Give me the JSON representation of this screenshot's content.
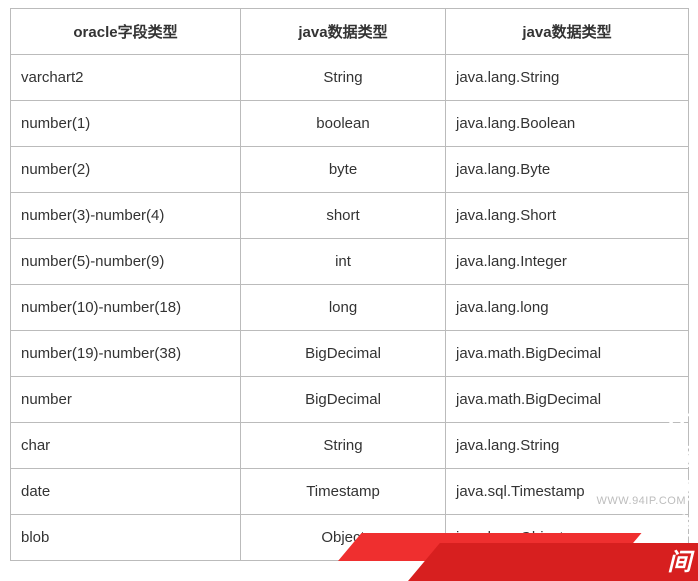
{
  "table": {
    "headers": [
      "oracle字段类型",
      "java数据类型",
      "java数据类型"
    ],
    "rows": [
      [
        "varchart2",
        "String",
        "java.lang.String"
      ],
      [
        "number(1)",
        "boolean",
        "java.lang.Boolean"
      ],
      [
        "number(2)",
        "byte",
        "java.lang.Byte"
      ],
      [
        "number(3)-number(4)",
        "short",
        "java.lang.Short"
      ],
      [
        "number(5)-number(9)",
        "int",
        "java.lang.Integer"
      ],
      [
        "number(10)-number(18)",
        "long",
        "java.lang.long"
      ],
      [
        "number(19)-number(38)",
        "BigDecimal",
        "java.math.BigDecimal"
      ],
      [
        "number",
        "BigDecimal",
        "java.math.BigDecimal"
      ],
      [
        "char",
        "String",
        "java.lang.String"
      ],
      [
        "date",
        "Timestamp",
        "java.sql.Timestamp"
      ],
      [
        "blob",
        "Object",
        "java.lang.Object"
      ]
    ]
  },
  "watermark": "WWW.94IP.COM",
  "banner": "IT运维空间"
}
